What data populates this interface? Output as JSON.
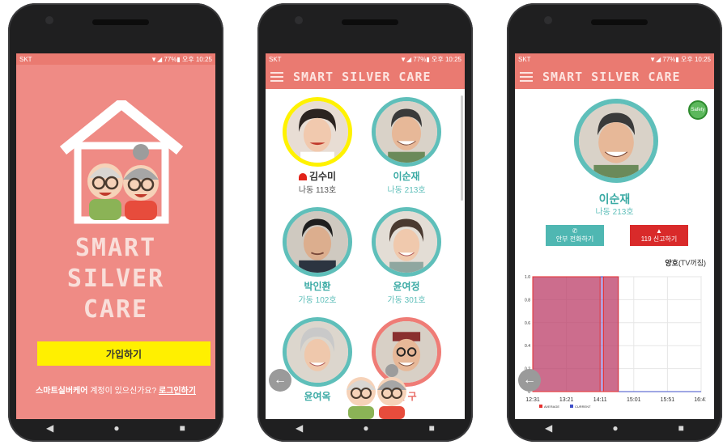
{
  "status_bar": {
    "carrier": "SKT",
    "indicators": "▼◢ 77%▮ 오후 10:25"
  },
  "app": {
    "title": "SMART SILVER CARE",
    "logo_lines": [
      "SMART",
      "SILVER",
      "CARE"
    ]
  },
  "login_screen": {
    "signup_label": "가입하기",
    "prompt_brand": "스마트실버케어",
    "prompt_text": " 계정이 있으신가요? ",
    "login_link": "로그인하기"
  },
  "residents": [
    {
      "name": "김수미",
      "room": "나동 113호",
      "alert": true
    },
    {
      "name": "이순재",
      "room": "나동 213호",
      "alert": false
    },
    {
      "name": "박인환",
      "room": "가동 102호",
      "alert": false
    },
    {
      "name": "윤여정",
      "room": "가동 301호",
      "alert": false
    },
    {
      "name": "윤여옥",
      "room": "",
      "alert": false
    },
    {
      "name": "신 구",
      "room": "",
      "alert": false
    }
  ],
  "detail": {
    "name": "이순재",
    "room": "나동 213호",
    "safety_badge": "Safety",
    "call_label": "안부 전화하기",
    "emergency_label": "119 신고하기",
    "status_prefix": "양호",
    "status_suffix": "(TV꺼짐)"
  },
  "chart_data": {
    "type": "area",
    "x_ticks": [
      "12:31",
      "13:21",
      "14:11",
      "15:01",
      "15:51",
      "16:41"
    ],
    "y_ticks": [
      "1.0",
      "0.8",
      "0.6",
      "0.4",
      "0.2",
      "0"
    ],
    "ylim": [
      0,
      1
    ],
    "legend": [
      "AVERAGE",
      "CURRENT"
    ],
    "legend_colors": [
      "#e8302f",
      "#3f4fc9"
    ],
    "series": [
      {
        "name": "AVERAGE",
        "x": [
          "12:31",
          "14:11",
          "14:11",
          "14:16",
          "14:16",
          "14:38"
        ],
        "values": [
          1,
          1,
          0,
          0,
          1,
          1
        ]
      },
      {
        "name": "CURRENT",
        "x": [
          "12:31",
          "14:11",
          "14:11",
          "14:38",
          "14:38",
          "16:41"
        ],
        "values": [
          1,
          1,
          1,
          1,
          0,
          0
        ]
      }
    ]
  },
  "nav": {
    "back": "◀",
    "home": "●",
    "recent": "■"
  },
  "colors": {
    "brand": "#ea7a71",
    "teal": "#5fbfba",
    "yellow": "#fff000"
  }
}
